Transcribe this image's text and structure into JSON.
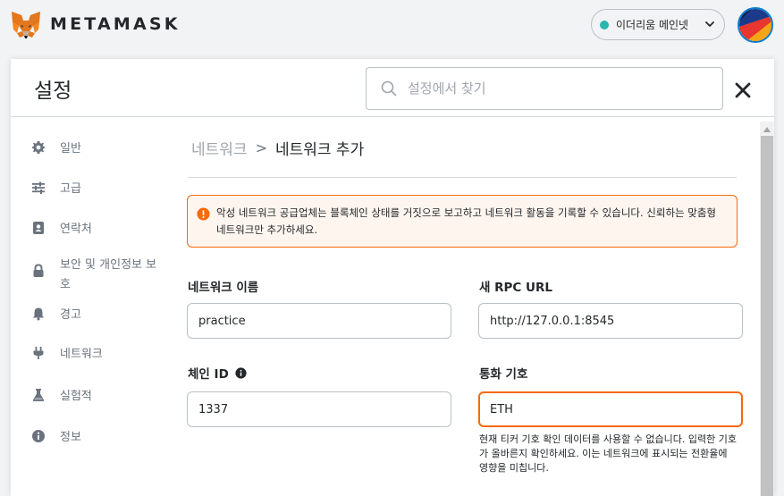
{
  "app": {
    "name": "METAMASK"
  },
  "network": {
    "label": "이더리움 메인넷",
    "dot_color": "#29b6af"
  },
  "header": {
    "title": "설정",
    "search": {
      "placeholder": "설정에서 찾기",
      "value": ""
    }
  },
  "sidebar": {
    "items": [
      {
        "label": "일반",
        "icon": "gear-icon"
      },
      {
        "label": "고급",
        "icon": "sliders-icon"
      },
      {
        "label": "연락처",
        "icon": "contact-book-icon"
      },
      {
        "label": "보안 및 개인정보 보호",
        "icon": "lock-icon"
      },
      {
        "label": "경고",
        "icon": "bell-icon"
      },
      {
        "label": "네트워크",
        "icon": "plug-icon"
      },
      {
        "label": "실험적",
        "icon": "flask-icon"
      },
      {
        "label": "정보",
        "icon": "info-icon"
      }
    ]
  },
  "breadcrumb": {
    "parent": "네트워크",
    "separator": ">",
    "current": "네트워크 추가"
  },
  "warning": {
    "text": "악성 네트워크 공급업체는 블록체인 상태를 거짓으로 보고하고 네트워크 활동을 기록할 수 있습니다. 신뢰하는 맞춤형 네트워크만 추가하세요."
  },
  "form": {
    "network_name": {
      "label": "네트워크 이름",
      "value": "practice"
    },
    "rpc_url": {
      "label": "새 RPC URL",
      "value": "http://127.0.0.1:8545"
    },
    "chain_id": {
      "label": "체인 ID",
      "value": "1337"
    },
    "currency_symbol": {
      "label": "통화 기호",
      "value": "ETH",
      "helper": "현재 티커 기호 확인 데이터를 사용할 수 없습니다. 입력한 기호가 올바른지 확인하세요. 이는 네트워크에 표시되는 전환율에 영향을 미칩니다."
    }
  },
  "colors": {
    "accent": "#037dd6",
    "warning": "#f66a0a",
    "muted": "#6a737d"
  }
}
